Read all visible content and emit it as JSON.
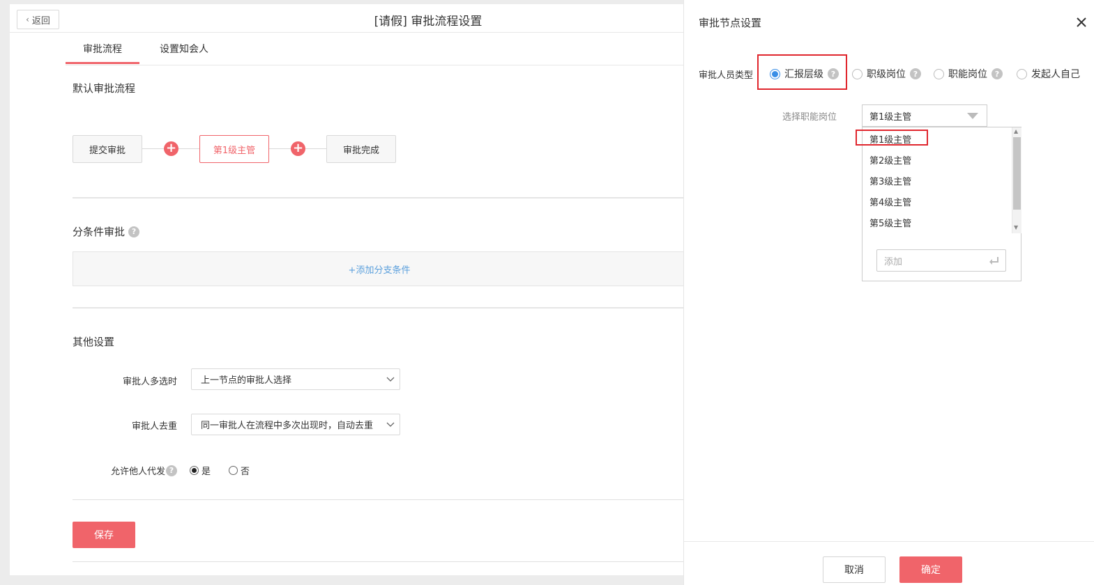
{
  "header": {
    "back_label": "返回",
    "title": "[请假] 审批流程设置"
  },
  "tabs": [
    {
      "label": "审批流程",
      "active": true
    },
    {
      "label": "设置知会人",
      "active": false
    }
  ],
  "default_flow": {
    "title": "默认审批流程",
    "nodes": [
      "提交审批",
      "第1级主管",
      "审批完成"
    ],
    "add_icon": "plus-circle-icon"
  },
  "branch": {
    "title": "分条件审批",
    "help_glyph": "?",
    "add_label": "+添加分支条件"
  },
  "other_settings": {
    "title": "其他设置",
    "multi_label": "审批人多选时",
    "multi_value": "上一节点的审批人选择",
    "dedup_label": "审批人去重",
    "dedup_value": "同一审批人在流程中多次出现时，自动去重",
    "proxy_label": "允许他人代发",
    "proxy_options": [
      "是",
      "否"
    ],
    "proxy_selected": "是"
  },
  "save_label": "保存",
  "drawer": {
    "title": "审批节点设置",
    "approver_type_label": "审批人员类型",
    "approver_types": [
      {
        "label": "汇报层级",
        "selected": true
      },
      {
        "label": "职级岗位",
        "selected": false
      },
      {
        "label": "职能岗位",
        "selected": false
      },
      {
        "label": "发起人自己",
        "selected": false
      }
    ],
    "position_label": "选择职能岗位",
    "position_value": "第1级主管",
    "position_options": [
      "第1级主管",
      "第2级主管",
      "第3级主管",
      "第4级主管",
      "第5级主管"
    ],
    "add_placeholder": "添加",
    "cancel_label": "取消",
    "confirm_label": "确定"
  },
  "colors": {
    "accent": "#f0646a",
    "link": "#5a9fdc",
    "radio_selected": "#3a8ee6",
    "highlight_box": "#e0262d"
  }
}
